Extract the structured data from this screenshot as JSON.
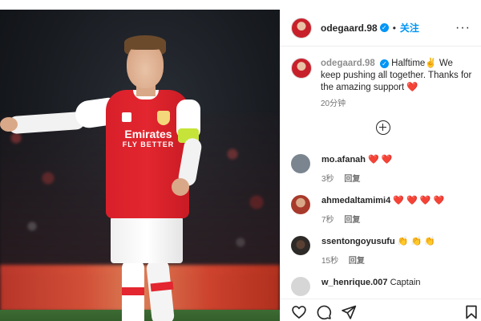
{
  "post": {
    "author": "odegaard.98",
    "separator": "•",
    "follow_label": "关注",
    "more_label": "···",
    "caption_text": "Halftime✌️ We keep pushing all together. Thanks for the amazing support ❤️",
    "caption_time": "20分钟",
    "photo": {
      "sponsor_line1": "Emirates",
      "sponsor_line2": "FLY BETTER"
    }
  },
  "comments": [
    {
      "username": "mo.afanah",
      "text": "❤️ ❤️",
      "time": "3秒",
      "reply_label": "回复",
      "avatar_color": "#7a8590"
    },
    {
      "username": "ahmedaltamimi4",
      "text": "❤️ ❤️ ❤️ ❤️",
      "time": "7秒",
      "reply_label": "回复",
      "avatar_color": "#a83a2c"
    },
    {
      "username": "ssentongoyusufu",
      "text": "👏 👏 👏",
      "time": "15秒",
      "reply_label": "回复",
      "avatar_color": "#2e2a28"
    },
    {
      "username": "w_henrique.007",
      "text": "Captain",
      "time": "",
      "reply_label": "",
      "avatar_color": "#c8c8c8"
    }
  ],
  "icons": {
    "like": "heart-icon",
    "comment": "comment-icon",
    "share": "send-icon",
    "save": "bookmark-icon",
    "add_comment": "plus-circle-icon",
    "verified": "verified-badge-icon"
  },
  "colors": {
    "link_blue": "#0095f6",
    "muted_text": "#737373",
    "jersey_red": "#e3262f"
  }
}
